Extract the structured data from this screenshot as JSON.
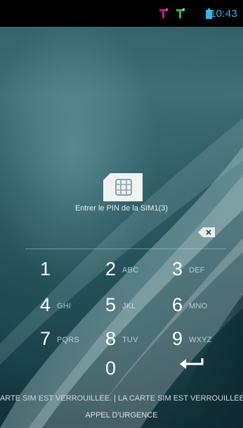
{
  "status_bar": {
    "time": "10:43",
    "signal_1_icon": "signal-icon",
    "signal_2_icon": "signal-icon",
    "battery_icon": "battery-icon",
    "time_color": "#33b5e5"
  },
  "sim_unlock": {
    "sim_icon": "sim-card-icon",
    "prompt": "Entrer le PIN de la SIM1(3)",
    "delete_icon": "backspace-icon"
  },
  "keypad": {
    "keys": [
      {
        "digit": "1",
        "letters": ""
      },
      {
        "digit": "2",
        "letters": "ABC"
      },
      {
        "digit": "3",
        "letters": "DEF"
      },
      {
        "digit": "4",
        "letters": "GHI"
      },
      {
        "digit": "5",
        "letters": "JKL"
      },
      {
        "digit": "6",
        "letters": "MNO"
      },
      {
        "digit": "7",
        "letters": "PQRS"
      },
      {
        "digit": "8",
        "letters": "TUV"
      },
      {
        "digit": "9",
        "letters": "WXYZ"
      },
      {
        "digit": "0",
        "letters": ""
      }
    ],
    "enter_icon": "enter-arrow-icon"
  },
  "footer": {
    "locked_message": "CARTE SIM EST VERROUILLÉE. | LA CARTE SIM EST VERROUILLÉE.",
    "emergency_label": "APPEL D'URGENCE"
  }
}
